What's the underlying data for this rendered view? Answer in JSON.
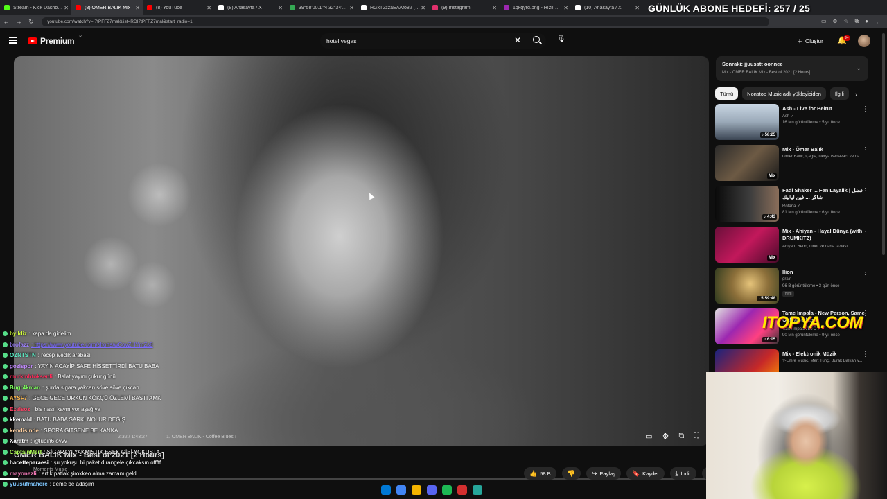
{
  "overlay_goal": "GÜNLÜK ABONE HEDEFİ: 257 / 25",
  "tabs": [
    {
      "label": "Stream - Kick Dashboard",
      "color": "#53fc18"
    },
    {
      "label": "(8) OMER BALIK Mix",
      "color": "#ff0000",
      "active": true
    },
    {
      "label": "(8) YouTube",
      "color": "#ff0000"
    },
    {
      "label": "(8) Anasayfa / X",
      "color": "#ffffff"
    },
    {
      "label": "39°58'00.1\"N 32°34'59.9\"",
      "color": "#34a853"
    },
    {
      "label": "HGxT2zzaEAAfo82 (524×",
      "color": "#ffffff"
    },
    {
      "label": "(9) Instagram",
      "color": "#e1306c"
    },
    {
      "label": "1qkqyrd.png - Hızlı Resim",
      "color": "#9c27b0"
    },
    {
      "label": "(10) Anasayfa / X",
      "color": "#ffffff"
    }
  ],
  "address": "youtube.com/watch?v=I7tPFFZ7mal&list=RDI7tPFFZ7mal&start_radio=1",
  "header": {
    "logo": "Premium",
    "logo_sup": "TR",
    "search_value": "hotel vegas",
    "create_label": "Oluştur",
    "notif_count": "9+"
  },
  "video": {
    "time": "2:32 / 1:43:27",
    "chapter": "1. OMER BALIK - Coffee Blues",
    "title": "OMER BALIK Mix - Best of 2021 [2 Hours]",
    "channel": "Moments Music",
    "progress": 0.025
  },
  "actions": {
    "likes": "58 B",
    "share": "Paylaş",
    "save": "Kaydet",
    "download": "İndir"
  },
  "upnext": {
    "line1": "Sonraki: jjuusstt oonnee",
    "line2": "Mix - OMER BALIK Mix - Best of 2021 [2 Hours]"
  },
  "chips": [
    "Tümü",
    "Nonstop Music adlı yükleyiciden",
    "İlgili"
  ],
  "recs": [
    {
      "title": "Ash - Live for Beirut",
      "channel": "Ash ✓",
      "meta": "16 Mn görüntüleme • 5 yıl önce",
      "duration": "♪ 58:25",
      "bg": "linear-gradient(180deg,#c9d6e3 0%,#9aa9b8 50%,#3a4452 100%)"
    },
    {
      "title": "Mix - Ömer Balık",
      "channel": "Ömer Balık, Çağla, Derya Bedavacı ve da...",
      "meta": "",
      "duration": "Mix",
      "bg": "linear-gradient(135deg,#2a2a2a 0%,#6d5a44 50%,#1a1a1a 100%)"
    },
    {
      "title": "Fadl Shaker ... Fen Layalik | فضل شاكر ... فين لياليك",
      "channel": "Rotana ✓",
      "meta": "81 Mn görüntüleme • 6 yıl önce",
      "duration": "♪ 4:43",
      "bg": "linear-gradient(90deg,#0a0a0a 0%,#3d3d3d 55%,#8a6e5a 100%)"
    },
    {
      "title": "Mix - Ahiyan - Hayal Dünya (with DRUMKITZ)",
      "channel": "Ahiyan, Bedo, Linet ve daha fazlası",
      "meta": "",
      "duration": "Mix",
      "bg": "linear-gradient(135deg,#6a0f3a 0%,#c2185b 50%,#4a0a2a 100%)"
    },
    {
      "title": "Ilion",
      "channel": "grain",
      "meta": "96 B görüntüleme • 3 gün önce",
      "badge": "Yeni",
      "duration": "♪ 5:59:48",
      "bg": "radial-gradient(circle at 55% 45%,#e5c37a 0%,#8c6f3a 45%,#2d3a1e 100%)"
    },
    {
      "title": "Tame Impala - New Person, Same Old Mistakes",
      "channel": "TameImpalaVEVO ✓",
      "meta": "90 Mn görüntüleme • 9 yıl önce",
      "duration": "♪ 6:05",
      "bg": "linear-gradient(135deg,#e0e0e0 0%,#9c27b0 40%,#ff4081 70%,#333 100%)"
    },
    {
      "title": "Mix - Elektronik Müzik",
      "channel": "Y-Emre Music, Mert Tunç, Burak Balkan v...",
      "meta": "",
      "duration": "Mix",
      "bg": "linear-gradient(135deg,#1a237e 0%,#c62828 60%,#ff9800 100%)"
    }
  ],
  "itopya": "ITOPYA.COM",
  "chat": [
    {
      "user": "byildiz",
      "color": "#d4ff3c",
      "msg": ": kapa da gidelim"
    },
    {
      "user": "brofazz",
      "color": "#a084ff",
      "msg": ": https://www.youtube.com/shorts/wCovZHYmZs8",
      "link": true
    },
    {
      "user": "OZNTSTN",
      "color": "#5cf0c8",
      "msg": ": recep ivedik arabası"
    },
    {
      "user": "gozispor",
      "color": "#c48cff",
      "msg": ": YAYIN ACAYİP SAFE HİSSETTİRDİ BATU BABA"
    },
    {
      "user": "murkinhtoksenli",
      "color": "#ff2a5a",
      "msg": ": Balat yayını çukur günü"
    },
    {
      "user": "Bugr4kman",
      "color": "#7dff5c",
      "msg": ": şurda sigara yakcan söve söve çıkcan"
    },
    {
      "user": "AYSF7",
      "color": "#ffb84a",
      "msg": ": GECE GECE ORKUN KÖKÇÜ ÖZLEMİ BASTI AMK"
    },
    {
      "user": "Ezelsoz",
      "color": "#ff4466",
      "msg": ": bis nasıl kaymıyor aşağıya"
    },
    {
      "user": "kkemald",
      "color": "#ffffff",
      "msg": ": BATU BABA ŞARKI NOLUR DEĞİŞ"
    },
    {
      "user": "kendisinde",
      "color": "#ffd0a0",
      "msg": ": SPORA GİTSENE BE KANKA"
    },
    {
      "user": "Xaratm",
      "color": "#ffffff",
      "msg": ": @lupin6 ovvv"
    },
    {
      "user": "CaptainMert",
      "color": "#b2ff59",
      "msg": ": SİGARAYI YAKMISTIK EŞEK GİBİ YOKUŞTA"
    },
    {
      "user": "hacetteparaesi",
      "color": "#ffffff",
      "msg": ": şu yokuşu bi paket d rangele çıkcaksın offfff"
    },
    {
      "user": "mayonezli",
      "color": "#ff80c0",
      "msg": ": artık patlak şirokkeo alma zamanı geldi"
    },
    {
      "user": "yuusufmahere",
      "color": "#80c8ff",
      "msg": ": deme be adaşım"
    }
  ],
  "taskbar_icons": [
    "windows-icon",
    "chrome-icon",
    "folder-icon",
    "discord-icon",
    "spotify-icon",
    "xbox-icon",
    "app-icon"
  ]
}
